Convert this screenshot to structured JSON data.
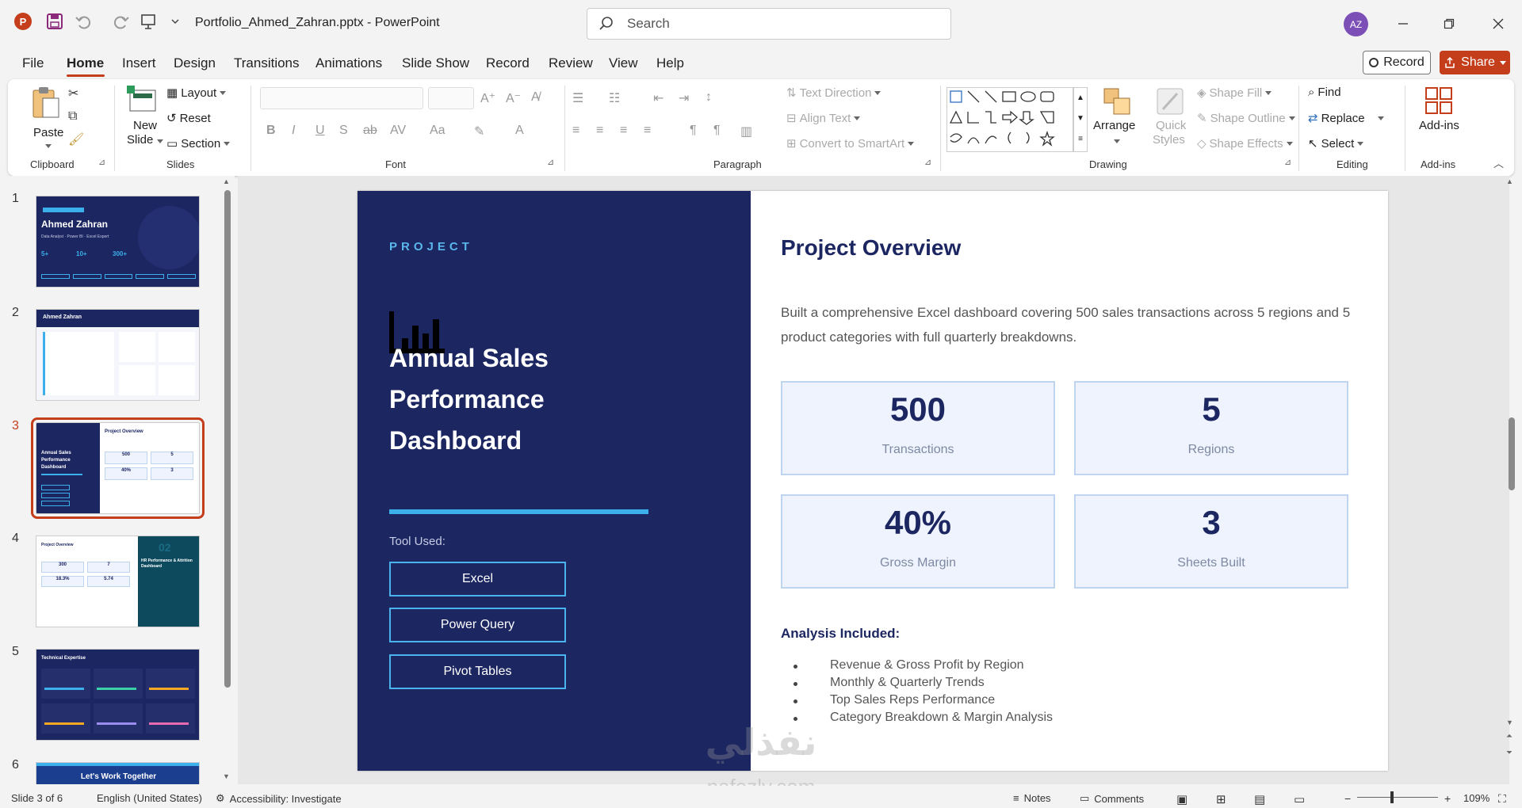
{
  "app": {
    "doc_title": "Portfolio_Ahmed_Zahran.pptx  -  PowerPoint",
    "search_placeholder": "Search",
    "avatar_initials": "AZ",
    "accent": "#c43e1c"
  },
  "menu": {
    "tabs": [
      "File",
      "Home",
      "Insert",
      "Design",
      "Transitions",
      "Animations",
      "Slide Show",
      "Record",
      "Review",
      "View",
      "Help"
    ],
    "record_label": "Record",
    "share_label": "Share"
  },
  "ribbon": {
    "clipboard": {
      "paste": "Paste",
      "label": "Clipboard"
    },
    "slides": {
      "new_slide": "New",
      "new_slide2": "Slide",
      "layout": "Layout",
      "reset": "Reset",
      "section": "Section",
      "label": "Slides"
    },
    "font": {
      "label": "Font",
      "bold": "B",
      "italic": "I",
      "underline": "U",
      "strike": "S",
      "abc": "ab"
    },
    "paragraph": {
      "label": "Paragraph",
      "text_direction": "Text Direction",
      "align_text": "Align Text",
      "smartart": "Convert to SmartArt"
    },
    "drawing": {
      "label": "Drawing",
      "arrange": "Arrange",
      "quick_styles": "Quick",
      "quick_styles2": "Styles",
      "shape_fill": "Shape Fill",
      "shape_outline": "Shape Outline",
      "shape_effects": "Shape Effects"
    },
    "editing": {
      "label": "Editing",
      "find": "Find",
      "replace": "Replace",
      "select": "Select"
    },
    "addins": {
      "label": "Add-ins",
      "addins_btn": "Add-ins"
    }
  },
  "thumbnails": {
    "numbers": [
      "1",
      "2",
      "3",
      "4",
      "5",
      "6"
    ],
    "t1_name": "Ahmed Zahran",
    "t1_sub": "Data Analyst  ·  Power BI  ·  Excel Expert",
    "t1_stats": [
      "5+",
      "10+",
      "300+"
    ],
    "t2_name": "Ahmed Zahran",
    "t3_title": "Project Overview",
    "t3_stats": [
      "500",
      "5",
      "40%",
      "3"
    ],
    "t4_title": "Project Overview",
    "t4_num": "02",
    "t4_side": "HR Performance & Attrition Dashboard",
    "t4_stats": [
      "300",
      "7",
      "18.3%",
      "5.74"
    ],
    "t5_title": "Technical Expertise",
    "t6_title": "Let's Work Together"
  },
  "slide": {
    "project_label": "PROJECT",
    "title_lines": [
      "Annual Sales",
      "Performance",
      "Dashboard"
    ],
    "tool_label": "Tool Used:",
    "tools": [
      "Excel",
      "Power Query",
      "Pivot Tables"
    ],
    "overview_title": "Project Overview",
    "overview_desc": "Built a comprehensive Excel dashboard covering 500 sales transactions across 5 regions and 5 product categories with full quarterly breakdowns.",
    "stats": [
      {
        "value": "500",
        "label": "Transactions"
      },
      {
        "value": "5",
        "label": "Regions"
      },
      {
        "value": "40%",
        "label": "Gross Margin"
      },
      {
        "value": "3",
        "label": "Sheets Built"
      }
    ],
    "analysis_label": "Analysis Included:",
    "analysis_items": [
      "Revenue & Gross Profit by Region",
      "Monthly & Quarterly Trends",
      "Top Sales Reps Performance",
      "Category Breakdown & Margin Analysis"
    ],
    "navy": "#1c2661",
    "cyan": "#3cb0ea"
  },
  "watermark": {
    "arabic": "نفذلي",
    "latin": "nafezly.com"
  },
  "status": {
    "slide_info": "Slide 3 of 6",
    "language": "English (United States)",
    "accessibility": "Accessibility: Investigate",
    "notes": "Notes",
    "comments": "Comments",
    "zoom_minus": "−",
    "zoom_plus": "+",
    "zoom": "109%"
  }
}
